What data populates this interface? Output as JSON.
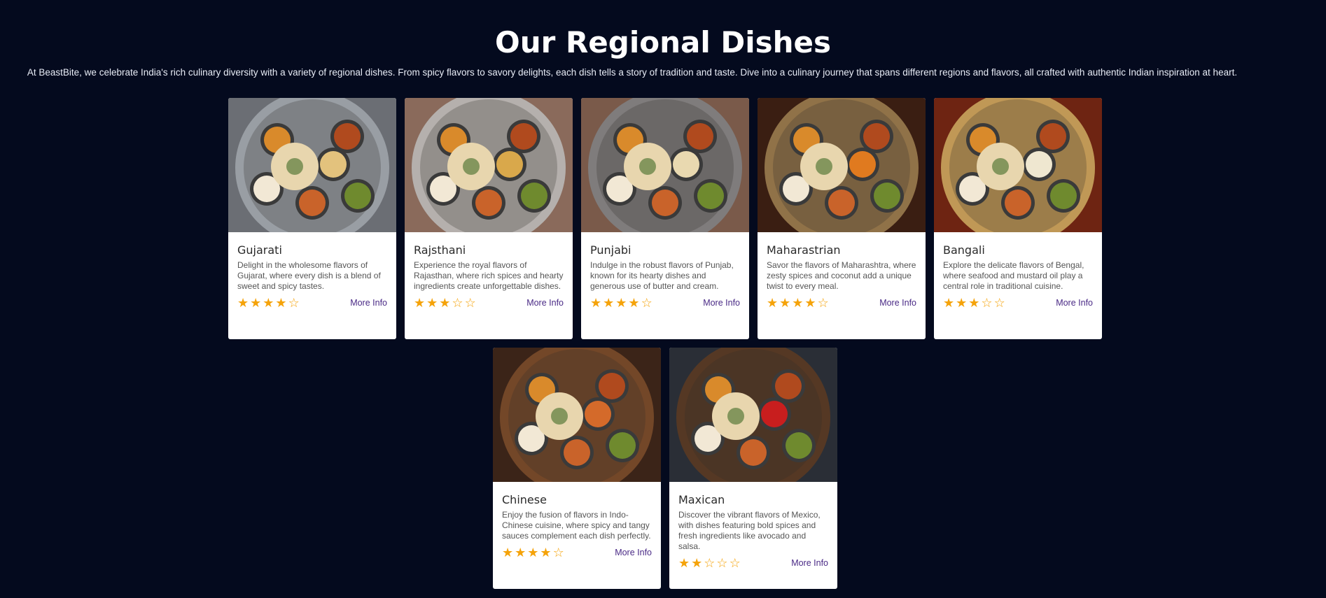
{
  "heading": "Our Regional Dishes",
  "intro": "At BeastBite, we celebrate India's rich culinary diversity with a variety of regional dishes. From spicy flavors to savory delights, each dish tells a story of tradition and taste. Dive into a culinary journey that spans different regions and flavors, all crafted with authentic Indian inspiration at heart.",
  "colors": {
    "background": "#040a1e",
    "star": "#f5a30a",
    "link": "#4a2a86"
  },
  "icons": {
    "star_filled": "star-icon",
    "star_empty": "star-outline-icon"
  },
  "cards": [
    {
      "name": "gujarati",
      "title": "Gujarati",
      "description": "Delight in the wholesome flavors of Gujarat, where every dish is a blend of sweet and spicy tastes.",
      "rating": 4,
      "link": "More Info",
      "theme": {
        "bg": "#6b6e74",
        "plate": "#9ea3aa",
        "accent": "#e3c27d"
      }
    },
    {
      "name": "rajsthani",
      "title": "Rajsthani",
      "description": "Experience the royal flavors of Rajasthan, where rich spices and hearty ingredients create unforgettable dishes.",
      "rating": 3,
      "link": "More Info",
      "theme": {
        "bg": "#8a6a5b",
        "plate": "#b9b8b6",
        "accent": "#d9a84b"
      }
    },
    {
      "name": "punjabi",
      "title": "Punjabi",
      "description": "Indulge in the robust flavors of Punjab, known for its hearty dishes and generous use of butter and cream.",
      "rating": 4,
      "link": "More Info",
      "theme": {
        "bg": "#7a5a4a",
        "plate": "#7f7f82",
        "accent": "#e9d9b0"
      }
    },
    {
      "name": "maharastrian",
      "title": "Maharastrian",
      "description": "Savor the flavors of Maharashtra, where zesty spices and coconut add a unique twist to every meal.",
      "rating": 4,
      "link": "More Info",
      "theme": {
        "bg": "#3a1e12",
        "plate": "#9a7b4f",
        "accent": "#e07a1f"
      }
    },
    {
      "name": "bangali",
      "title": "Bangali",
      "description": "Explore the delicate flavors of Bengal, where seafood and mustard oil play a central role in traditional cuisine.",
      "rating": 3,
      "link": "More Info",
      "theme": {
        "bg": "#6e2412",
        "plate": "#c9a55e",
        "accent": "#efe7d0"
      }
    },
    {
      "name": "chinese",
      "title": "Chinese",
      "description": "Enjoy the fusion of flavors in Indo-Chinese cuisine, where spicy and tangy sauces complement each dish perfectly.",
      "rating": 4,
      "link": "More Info",
      "theme": {
        "bg": "#3b2418",
        "plate": "#7a4b2a",
        "accent": "#d46a2a"
      }
    },
    {
      "name": "maxican",
      "title": "Maxican",
      "description": "Discover the vibrant flavors of Mexico, with dishes featuring bold spices and fresh ingredients like avocado and salsa.",
      "rating": 2,
      "link": "More Info",
      "theme": {
        "bg": "#2a2e36",
        "plate": "#5a3a22",
        "accent": "#c81e1e"
      }
    }
  ]
}
